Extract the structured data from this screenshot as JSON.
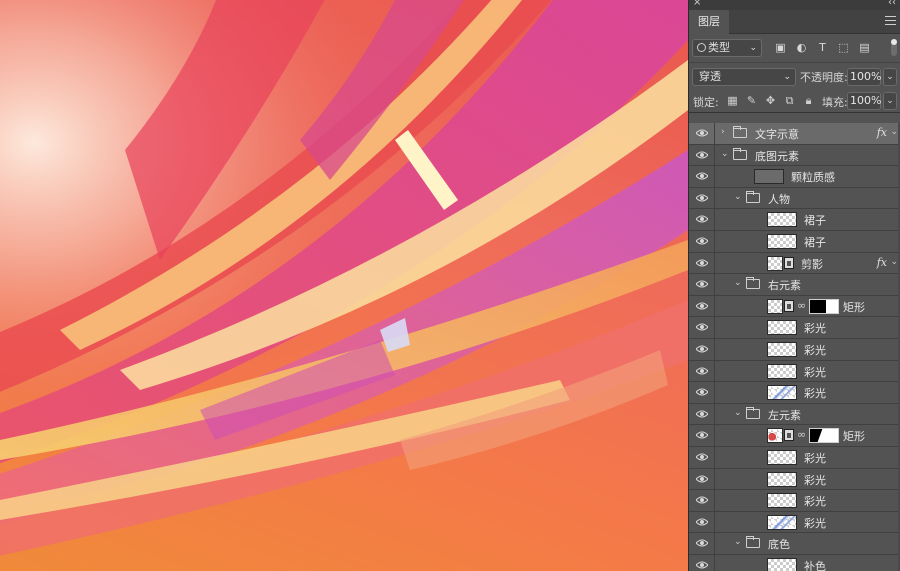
{
  "panel": {
    "close_glyph": "×",
    "collapse_glyph": "‹‹",
    "tab_label": "图层",
    "filter": {
      "kind_label": "类型"
    },
    "blend_mode": "穿透",
    "opacity_label": "不透明度:",
    "opacity_value": "100%",
    "lock_label": "锁定:",
    "fill_label": "填充:",
    "fill_value": "100%",
    "icons": {
      "filter": [
        "image-filter-icon",
        "adjustment-filter-icon",
        "text-filter-icon",
        "shape-filter-icon",
        "smart-object-filter-icon"
      ],
      "lock": [
        "lock-transparent-icon",
        "lock-image-icon",
        "lock-position-icon",
        "lock-artboard-icon",
        "lock-all-icon"
      ]
    }
  },
  "layers": [
    {
      "name": "文字示意",
      "kind": "group",
      "level": 0,
      "expanded": false,
      "fx": true,
      "selected": true
    },
    {
      "name": "底图元素",
      "kind": "group",
      "level": 0,
      "expanded": true
    },
    {
      "name": "颗粒质感",
      "kind": "texture",
      "level": 1
    },
    {
      "name": "人物",
      "kind": "group",
      "level": 1,
      "expanded": true
    },
    {
      "name": "裙子",
      "kind": "pixel",
      "level": 2
    },
    {
      "name": "裙子",
      "kind": "pixel",
      "level": 2
    },
    {
      "name": "剪影",
      "kind": "smart",
      "level": 2,
      "fx": true
    },
    {
      "name": "右元素",
      "kind": "group",
      "level": 1,
      "expanded": true
    },
    {
      "name": "矩形",
      "kind": "smart-mask",
      "level": 2
    },
    {
      "name": "彩光",
      "kind": "pixel",
      "level": 2
    },
    {
      "name": "彩光",
      "kind": "pixel",
      "level": 2
    },
    {
      "name": "彩光",
      "kind": "pixel",
      "level": 2
    },
    {
      "name": "彩光",
      "kind": "pixel-blue",
      "level": 2
    },
    {
      "name": "左元素",
      "kind": "group",
      "level": 1,
      "expanded": true
    },
    {
      "name": "矩形",
      "kind": "smart-mask-left",
      "level": 2
    },
    {
      "name": "彩光",
      "kind": "pixel",
      "level": 2
    },
    {
      "name": "彩光",
      "kind": "pixel",
      "level": 2
    },
    {
      "name": "彩光",
      "kind": "pixel",
      "level": 2
    },
    {
      "name": "彩光",
      "kind": "pixel-blue",
      "level": 2
    },
    {
      "name": "底色",
      "kind": "group",
      "level": 1,
      "expanded": true
    },
    {
      "name": "补色",
      "kind": "pixel",
      "level": 2
    }
  ],
  "colors": {
    "panel_bg": "#535353",
    "selected_row": "#6a6a6a",
    "canvas_red": "#e9564e",
    "canvas_orange": "#f08a3a",
    "canvas_pink": "#e0569a",
    "canvas_yellow": "#f7d070"
  }
}
